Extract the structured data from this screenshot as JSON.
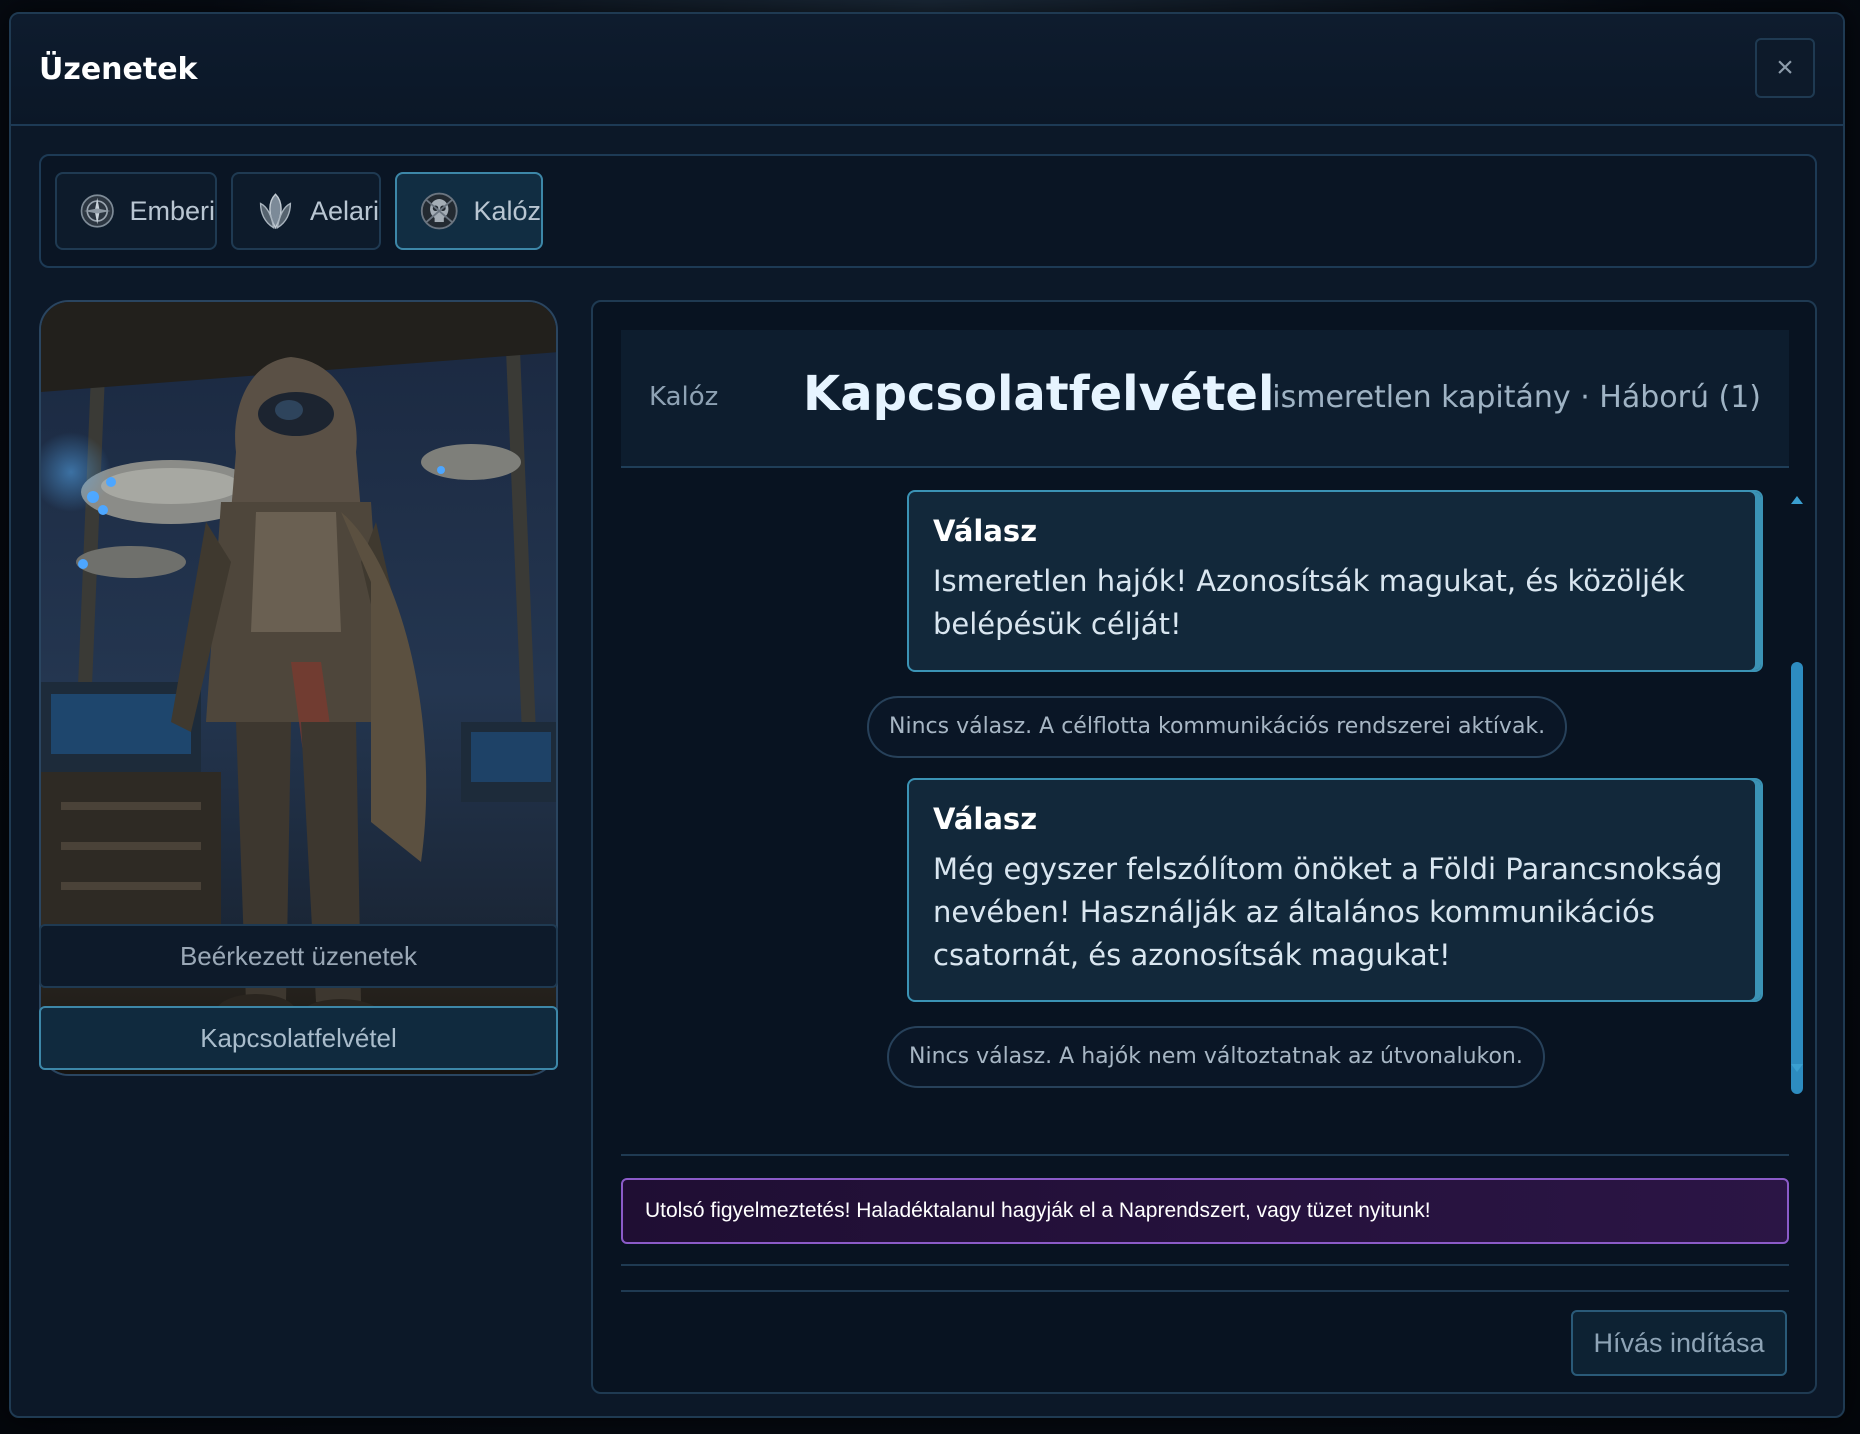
{
  "window": {
    "title": "Üzenetek",
    "close_label": "×"
  },
  "tabs": [
    {
      "label": "Emberi",
      "icon": "human-faction-icon",
      "active": false
    },
    {
      "label": "Aelari",
      "icon": "aelari-faction-icon",
      "active": false
    },
    {
      "label": "Kalóz",
      "icon": "pirate-faction-icon",
      "active": true
    }
  ],
  "sidebar": {
    "inbox_label": "Beérkezett üzenetek",
    "contact_label": "Kapcsolatfelvétel"
  },
  "conversation": {
    "faction": "Kalóz",
    "title": "Kapcsolatfelvétel",
    "meta": "ismeretlen kapitány · Háború (1)",
    "messages": [
      {
        "type": "reply",
        "title": "Válasz",
        "body": "Ismeretlen hajók! Azonosítsák magukat, és közöljék belépésük célját!"
      },
      {
        "type": "system",
        "text": "Nincs válasz. A célflotta kommunikációs rendszerei aktívak."
      },
      {
        "type": "reply",
        "title": "Válasz",
        "body": "Még egyszer felszólítom önöket a Földi Parancsnokság nevében! Használják az általános kommunikációs csatornát, és azonosítsák magukat!"
      },
      {
        "type": "system",
        "text": "Nincs válasz. A hajók nem változtatnak az útvonalukon."
      }
    ],
    "selected_option": "Utolsó figyelmeztetés! Haladéktalanul hagyják el a Naprendszert, vagy tüzet nyitunk!",
    "call_button": "Hívás indítása"
  },
  "colors": {
    "accent": "#3b93b5",
    "warning_border": "#8b5bc8",
    "background": "#0c1828"
  }
}
